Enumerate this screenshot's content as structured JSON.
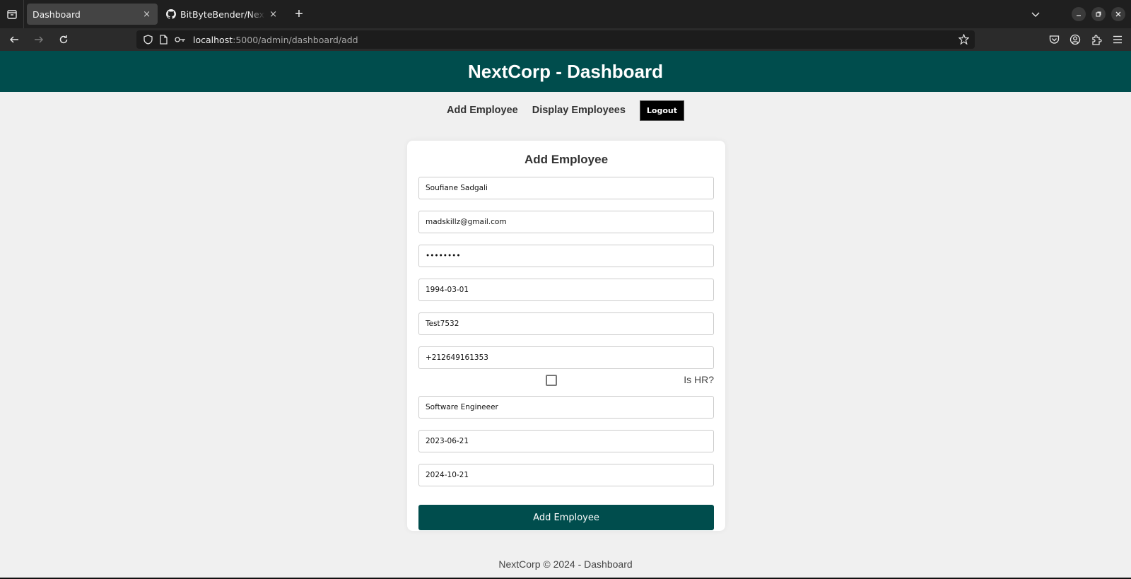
{
  "browser": {
    "tabs": [
      {
        "label": "Dashboard",
        "active": true
      },
      {
        "label": "BitByteBender/Next_Corp",
        "active": false
      }
    ],
    "url_host": "localhost",
    "url_rest": ":5000/admin/dashboard/add",
    "new_tab_symbol": "+",
    "close_symbol": "×"
  },
  "header": {
    "title": "NextCorp - Dashboard"
  },
  "nav": {
    "add_employee": "Add Employee",
    "display_employees": "Display Employees",
    "logout": "Logout"
  },
  "form": {
    "title": "Add Employee",
    "fields": {
      "full_name": "Soufiane Sadgali",
      "email": "madskillz@gmail.com",
      "password": "Test7532",
      "birth_date": "1994-03-01",
      "username": "Test7532",
      "phone": "+212649161353",
      "position": "Software Engineeer",
      "hire_date": "2023-06-21",
      "end_date": "2024-10-21"
    },
    "is_hr_label": "Is HR?",
    "is_hr_checked": false,
    "submit_label": "Add Employee"
  },
  "footer": {
    "text": "NextCorp © 2024 - Dashboard"
  },
  "colors": {
    "brand": "#004d4d",
    "background": "#f0f0f0"
  }
}
